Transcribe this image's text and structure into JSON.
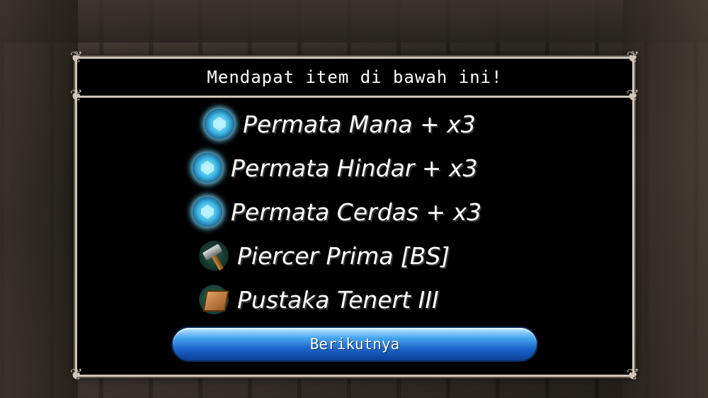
{
  "dialog": {
    "title": "Mendapat item di bawah ini!",
    "items": [
      {
        "label": "Permata Mana + x3",
        "icon": "mana-gem-icon"
      },
      {
        "label": "Permata Hindar + x3",
        "icon": "evade-gem-icon"
      },
      {
        "label": "Permata Cerdas + x3",
        "icon": "intelligence-gem-icon"
      },
      {
        "label": "Piercer Prima [BS]",
        "icon": "hammer-icon"
      },
      {
        "label": "Pustaka Tenert III",
        "icon": "book-icon"
      }
    ],
    "next_button_label": "Berikutnya"
  },
  "colors": {
    "dialog_bg": "#000000",
    "border": "#cfc6b8",
    "button": "#1a63c9"
  }
}
